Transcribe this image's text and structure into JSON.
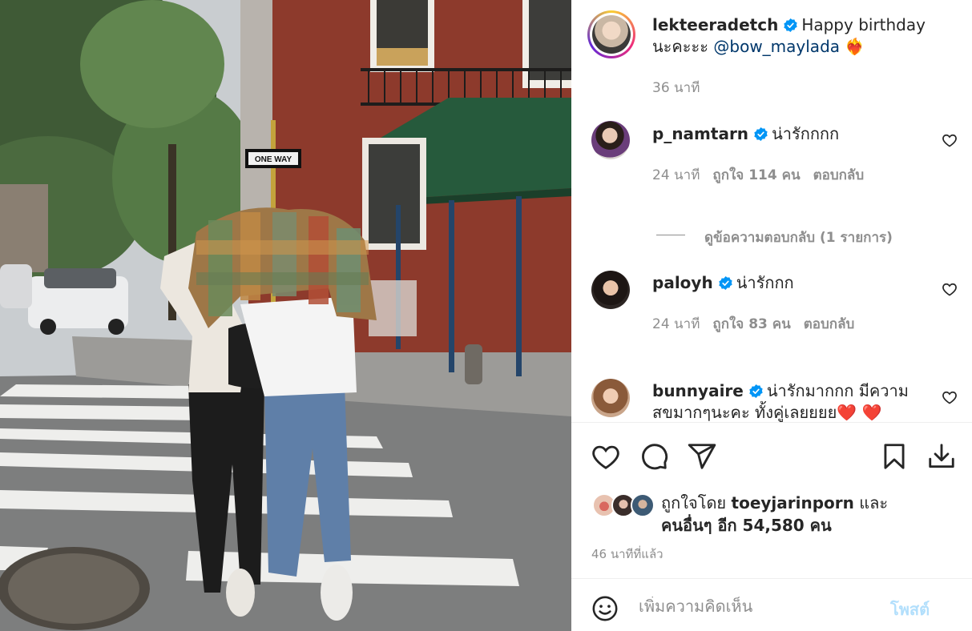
{
  "post": {
    "author": {
      "username": "lekteeradetch",
      "verified": true,
      "caption_line1": "Happy birthday",
      "caption_line2_prefix": "นะคะะะ",
      "caption_mention": "@bow_maylada",
      "caption_emoji": "❤️‍🔥",
      "time": "36 นาที"
    },
    "comments": [
      {
        "username": "p_namtarn",
        "verified": true,
        "text": "น่ารักกกก",
        "time": "24 นาที",
        "likes": "ถูกใจ 114 คน",
        "reply": "ตอบกลับ",
        "view_replies": "ดูข้อความตอบกลับ (1 รายการ)"
      },
      {
        "username": "paloyh",
        "verified": true,
        "text": "น่ารักกก",
        "time": "24 นาที",
        "likes": "ถูกใจ 83 คน",
        "reply": "ตอบกลับ"
      },
      {
        "username": "bunnyaire",
        "verified": true,
        "text_line1": "น่ารักมากกก มีความ",
        "text_line2": "สขมากๆนะคะ ทั้งคู่เลยยยย",
        "hearts": "❤️ ❤️"
      }
    ],
    "liked_by": {
      "prefix": "ถูกใจโดย",
      "user": "toeyjarinporn",
      "and": "และ",
      "others": "คนอื่นๆ อีก 54,580 คน"
    },
    "post_time": "46 นาทีที่แล้ว",
    "comment_box": {
      "placeholder": "เพิ่มความคิดเห็น",
      "post_label": "โพสต์"
    },
    "photo": {
      "street_sign": "ONE WAY"
    },
    "colors": {
      "link": "#00376b",
      "verified": "#0095f6",
      "muted": "#8e8e8e",
      "post_button": "#b2dffc"
    },
    "icons": [
      "heart-icon",
      "comment-icon",
      "share-icon",
      "bookmark-icon",
      "download-icon",
      "emoji-icon",
      "verified-icon"
    ]
  }
}
